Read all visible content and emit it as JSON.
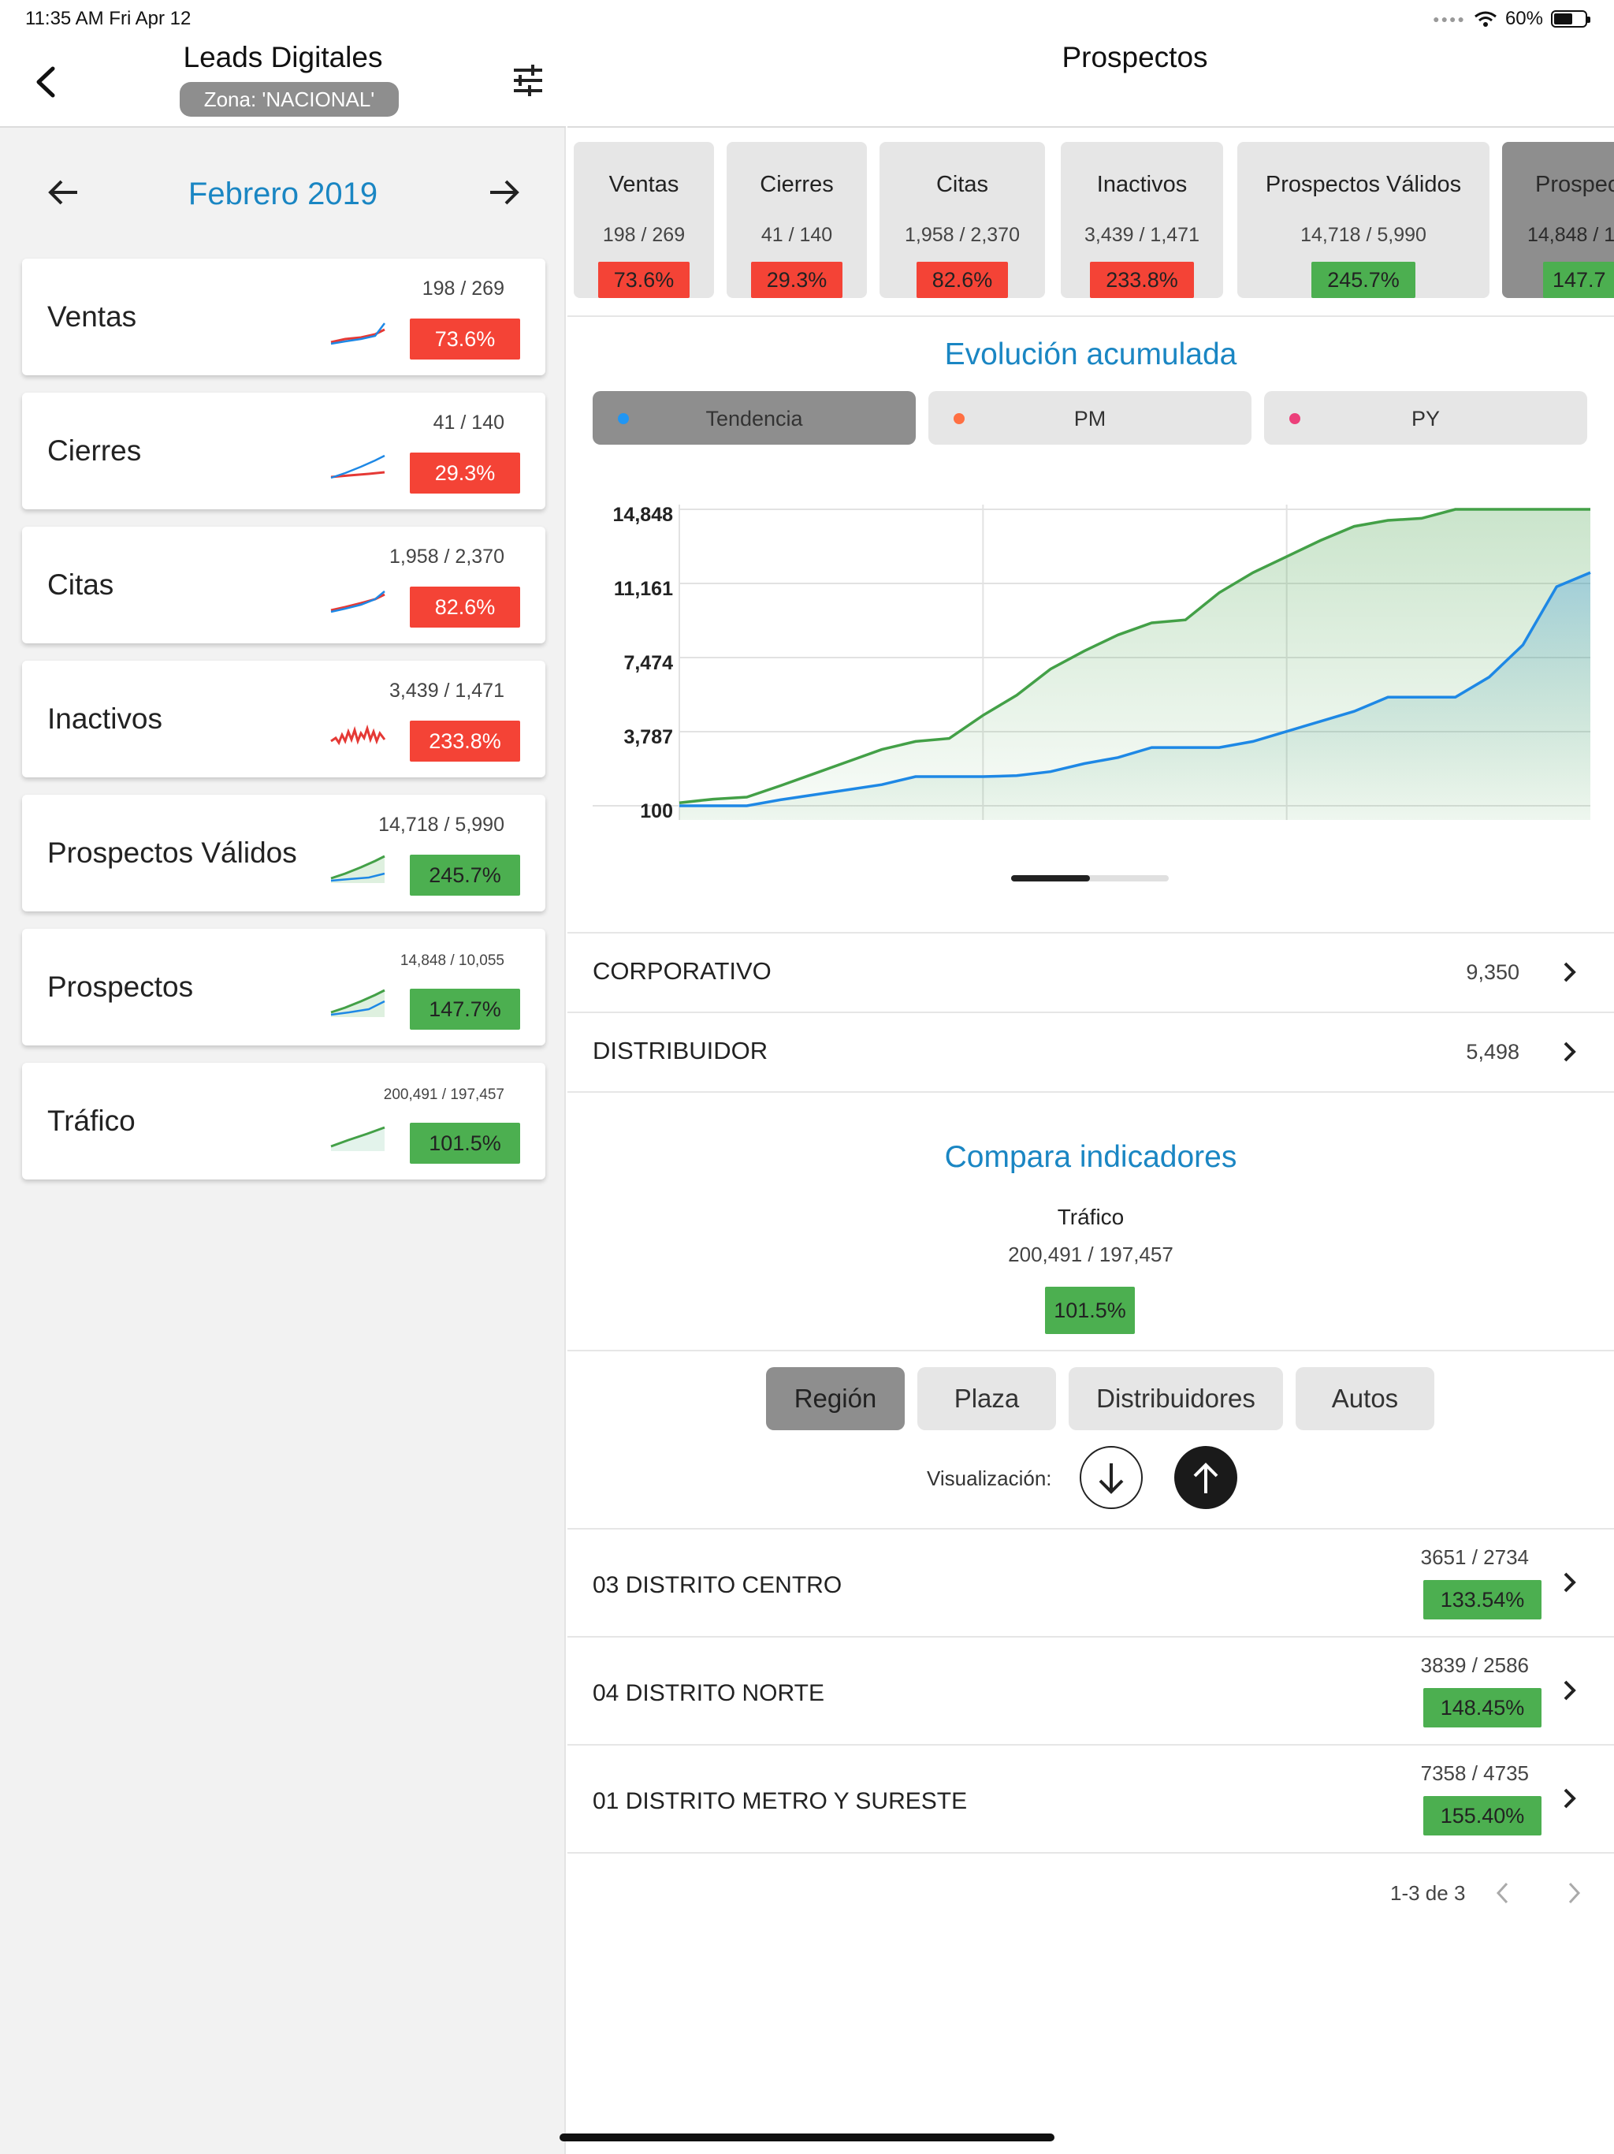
{
  "status_bar": {
    "time": "11:35 AM   Fri Apr 12",
    "battery": "60%",
    "battery_level": 0.6
  },
  "left": {
    "title": "Leads Digitales",
    "zona": "Zona: 'NACIONAL'",
    "month": "Febrero 2019",
    "metrics": [
      {
        "name": "Ventas",
        "ratio": "198 / 269",
        "pct": "73.6%",
        "status": "bad",
        "spark": "dual"
      },
      {
        "name": "Cierres",
        "ratio": "41 / 140",
        "pct": "29.3%",
        "status": "bad",
        "spark": "dual"
      },
      {
        "name": "Citas",
        "ratio": "1,958 / 2,370",
        "pct": "82.6%",
        "status": "bad",
        "spark": "dual"
      },
      {
        "name": "Inactivos",
        "ratio": "3,439 / 1,471",
        "pct": "233.8%",
        "status": "bad",
        "spark": "jagged"
      },
      {
        "name": "Prospectos Válidos",
        "ratio": "14,718 / 5,990",
        "pct": "245.7%",
        "status": "good",
        "spark": "green"
      },
      {
        "name": "Prospectos",
        "ratio": "14,848 / 10,055",
        "pct": "147.7%",
        "status": "good",
        "spark": "green"
      },
      {
        "name": "Tráfico",
        "ratio": "200,491 / 197,457",
        "pct": "101.5%",
        "status": "good",
        "spark": "single"
      }
    ]
  },
  "right": {
    "title": "Prospectos",
    "kpis": [
      {
        "name": "Ventas",
        "ratio": "198 / 269",
        "pct": "73.6%",
        "status": "bad",
        "active": false
      },
      {
        "name": "Cierres",
        "ratio": "41 / 140",
        "pct": "29.3%",
        "status": "bad",
        "active": false
      },
      {
        "name": "Citas",
        "ratio": "1,958 / 2,370",
        "pct": "82.6%",
        "status": "bad",
        "active": false
      },
      {
        "name": "Inactivos",
        "ratio": "3,439 / 1,471",
        "pct": "233.8%",
        "status": "bad",
        "active": false
      },
      {
        "name": "Prospectos Válidos",
        "ratio": "14,718 / 5,990",
        "pct": "245.7%",
        "status": "good",
        "active": false
      },
      {
        "name": "Prospec",
        "ratio": "14,848 / 1",
        "pct": "147.7",
        "status": "good",
        "active": true
      }
    ],
    "evolution_title": "Evolución acumulada",
    "series_toggles": [
      {
        "label": "Tendencia",
        "dot_color": "#2196f3",
        "active": true
      },
      {
        "label": "PM",
        "dot_color": "#ff7043",
        "active": false
      },
      {
        "label": "PY",
        "dot_color": "#ec407a",
        "active": false
      }
    ],
    "groups": [
      {
        "name": "CORPORATIVO",
        "value": "9,350"
      },
      {
        "name": "DISTRIBUIDOR",
        "value": "5,498"
      }
    ],
    "compare_title": "Compara indicadores",
    "compare": {
      "name": "Tráfico",
      "ratio": "200,491 / 197,457",
      "pct": "101.5%"
    },
    "segments": [
      {
        "label": "Región",
        "active": true
      },
      {
        "label": "Plaza",
        "active": false
      },
      {
        "label": "Distribuidores",
        "active": false
      },
      {
        "label": "Autos",
        "active": false
      }
    ],
    "viz_label": "Visualización:",
    "regions": [
      {
        "name": "03 DISTRITO CENTRO",
        "ratio": "3651 / 2734",
        "pct": "133.54%"
      },
      {
        "name": "04 DISTRITO NORTE",
        "ratio": "3839 / 2586",
        "pct": "148.45%"
      },
      {
        "name": "01 DISTRITO METRO Y SURESTE",
        "ratio": "7358 / 4735",
        "pct": "155.40%"
      }
    ],
    "pagination": "1-3 de 3"
  },
  "colors": {
    "accent": "#1a86c3",
    "bad": "#f44336",
    "good": "#4caf50",
    "line_green": "#43a047",
    "line_blue": "#1e88e5"
  },
  "chart_data": {
    "type": "area",
    "yticks": [
      "14,848",
      "11,161",
      "7,474",
      "3,787",
      "100"
    ],
    "ylim": [
      100,
      14848
    ],
    "x": [
      1,
      2,
      3,
      4,
      5,
      6,
      7,
      8,
      9,
      10,
      11,
      12,
      13,
      14,
      15,
      16,
      17,
      18,
      19,
      20,
      21,
      22,
      23,
      24,
      25,
      26,
      27,
      28
    ],
    "series": [
      {
        "values": [
          250,
          430,
          530,
          1100,
          1700,
          2300,
          2900,
          3300,
          3450,
          4600,
          5600,
          6900,
          7800,
          8600,
          9200,
          9350,
          10700,
          11700,
          12500,
          13300,
          14000,
          14300,
          14400,
          15300,
          15700,
          16000,
          16300,
          16600
        ]
      },
      {
        "values": [
          100,
          100,
          100,
          400,
          650,
          900,
          1150,
          1550,
          1550,
          1550,
          1600,
          1800,
          2200,
          2500,
          3000,
          3000,
          3000,
          3300,
          3800,
          4300,
          4800,
          5500,
          5500,
          5500,
          6500,
          8100,
          11000,
          11700
        ]
      }
    ]
  }
}
